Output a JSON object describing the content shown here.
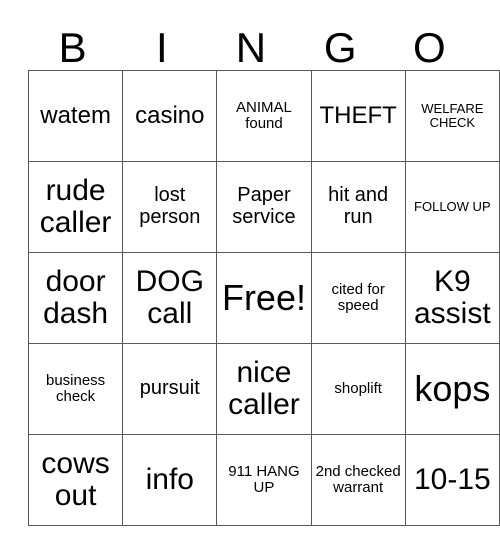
{
  "card": {
    "title": "BINGO",
    "header": [
      "B",
      "I",
      "N",
      "G",
      "O"
    ],
    "rows": [
      [
        {
          "text": "watem",
          "size": "fs-md"
        },
        {
          "text": "casino",
          "size": "fs-md"
        },
        {
          "text": "ANIMAL found",
          "size": "fs-xs"
        },
        {
          "text": "THEFT",
          "size": "fs-md"
        },
        {
          "text": "WELFARE CHECK",
          "size": "fs-xxs"
        }
      ],
      [
        {
          "text": "rude caller",
          "size": "fs-lg"
        },
        {
          "text": "lost person",
          "size": "fs-sm"
        },
        {
          "text": "Paper service",
          "size": "fs-sm"
        },
        {
          "text": "hit and run",
          "size": "fs-sm"
        },
        {
          "text": "FOLLOW UP",
          "size": "fs-xxs"
        }
      ],
      [
        {
          "text": "door dash",
          "size": "fs-lg"
        },
        {
          "text": "DOG call",
          "size": "fs-lg"
        },
        {
          "text": "Free!",
          "size": "fs-xl"
        },
        {
          "text": "cited for speed",
          "size": "fs-xs"
        },
        {
          "text": "K9 assist",
          "size": "fs-lg"
        }
      ],
      [
        {
          "text": "business check",
          "size": "fs-xs"
        },
        {
          "text": "pursuit",
          "size": "fs-sm"
        },
        {
          "text": "nice caller",
          "size": "fs-lg"
        },
        {
          "text": "shoplift",
          "size": "fs-xs"
        },
        {
          "text": "kops",
          "size": "fs-xl"
        }
      ],
      [
        {
          "text": "cows out",
          "size": "fs-lg"
        },
        {
          "text": "info",
          "size": "fs-lg"
        },
        {
          "text": "911 HANG UP",
          "size": "fs-xs"
        },
        {
          "text": "2nd checked warrant",
          "size": "fs-xs"
        },
        {
          "text": "10-15",
          "size": "fs-lg"
        }
      ]
    ]
  },
  "colors": {
    "border": "#595959",
    "text": "#000000",
    "background": "#ffffff"
  }
}
